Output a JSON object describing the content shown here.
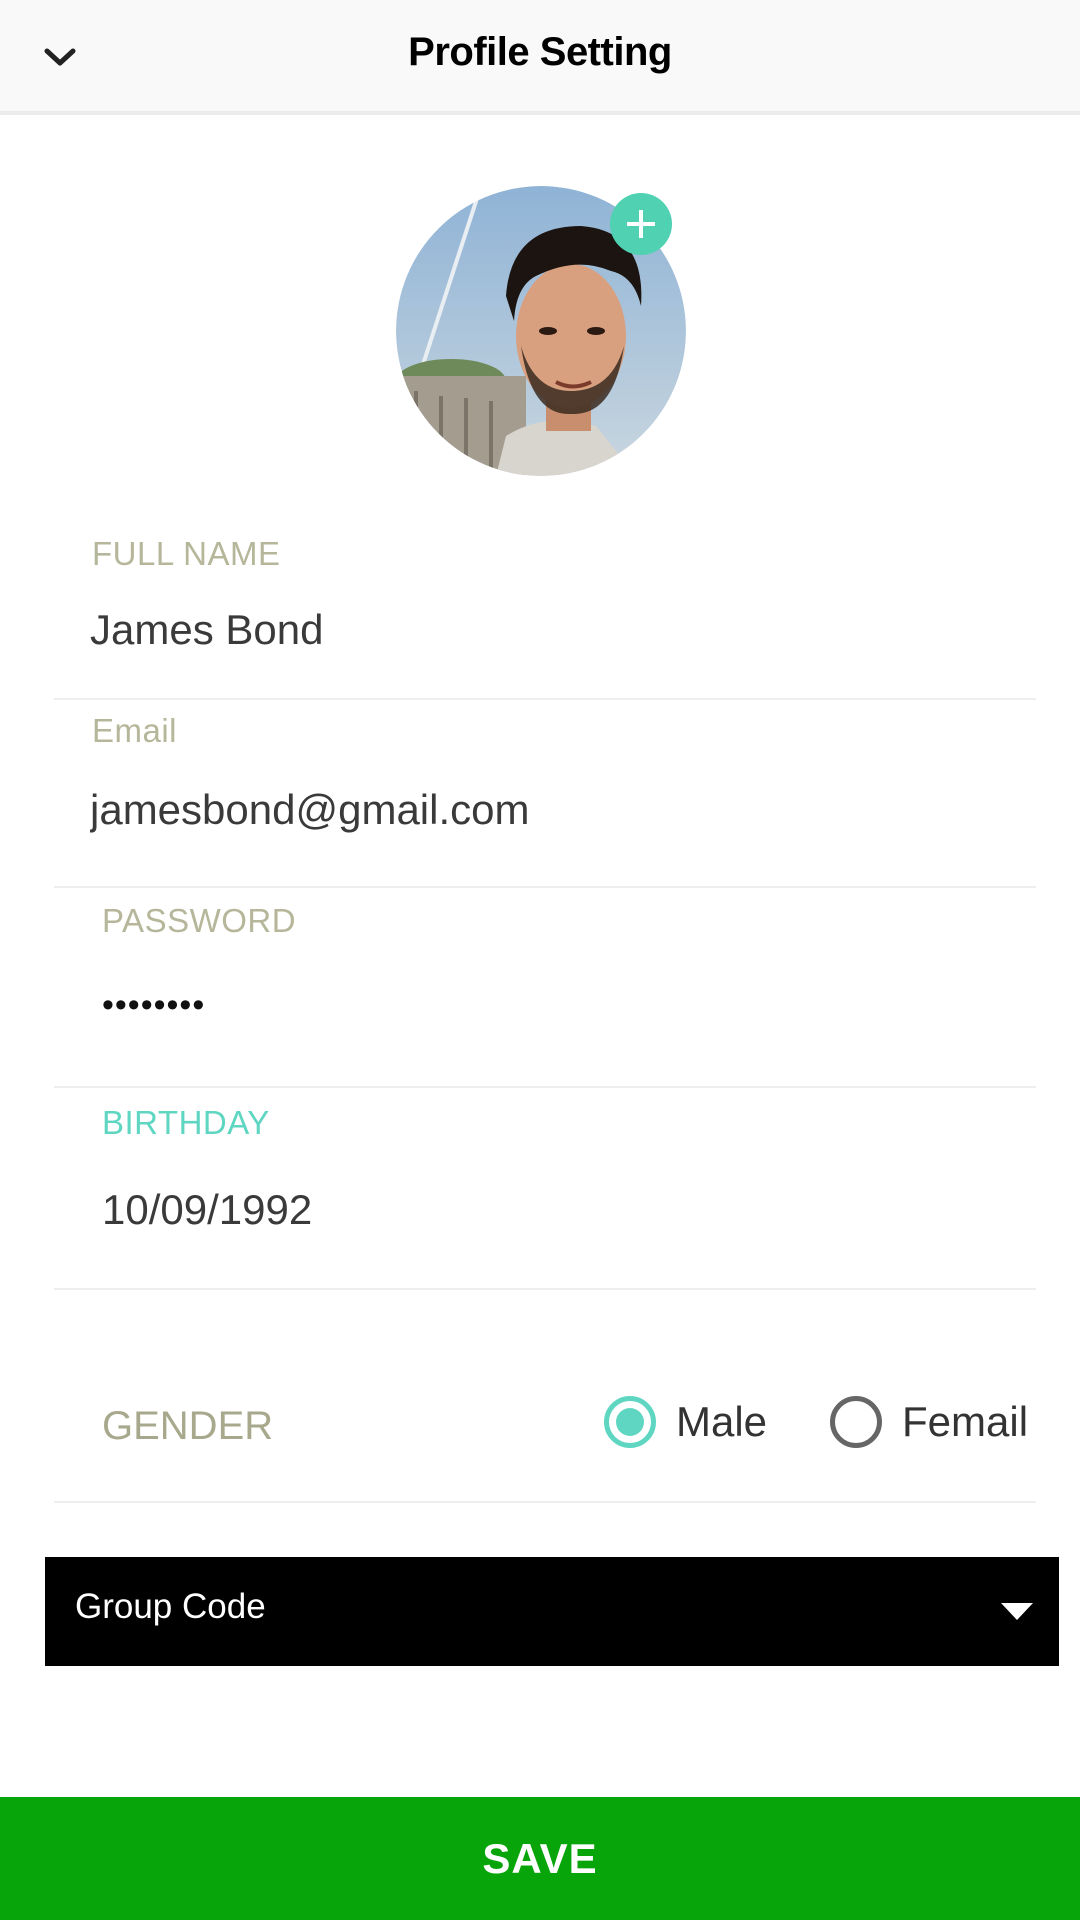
{
  "header": {
    "title": "Profile Setting",
    "back_icon": "chevron-down-icon"
  },
  "profile": {
    "avatar_icon": "user-photo",
    "add_photo_icon": "plus-icon",
    "accent_color": "#4fd1b2"
  },
  "form": {
    "full_name": {
      "label": "FULL NAME",
      "value": "James Bond"
    },
    "email": {
      "label": "Email",
      "value": "jamesbond@gmail.com"
    },
    "password": {
      "label": "PASSWORD",
      "value": "••••••••"
    },
    "birthday": {
      "label": "BIRTHDAY",
      "value": "10/09/1992"
    }
  },
  "gender": {
    "label": "GENDER",
    "options": [
      {
        "label": "Male",
        "selected": true
      },
      {
        "label": "Femail",
        "selected": false
      }
    ]
  },
  "group_code": {
    "label": "Group Code",
    "icon": "caret-down-icon"
  },
  "actions": {
    "save_label": "SAVE",
    "save_color": "#08a50a"
  }
}
